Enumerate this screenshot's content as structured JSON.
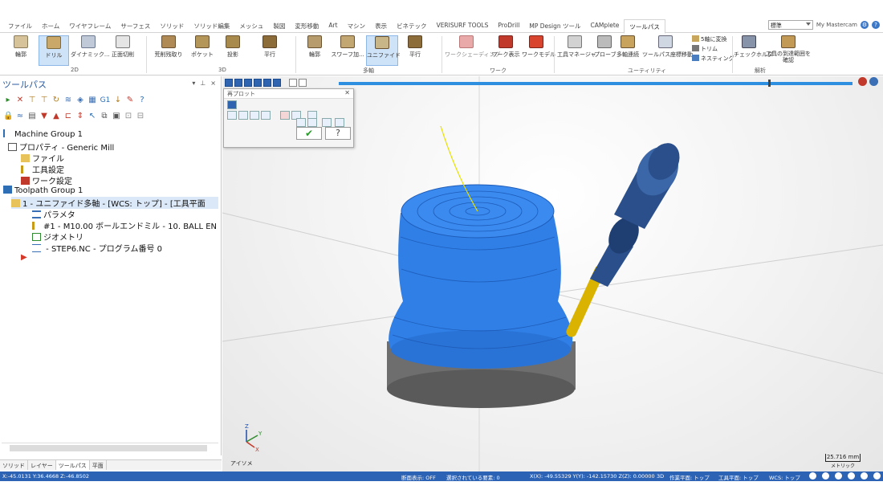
{
  "ribbon_tabs": [
    "ファイル",
    "ホーム",
    "ワイヤフレーム",
    "サーフェス",
    "ソリッド",
    "ソリッド編集",
    "メッシュ",
    "製図",
    "変形移動",
    "Art",
    "マシン",
    "表示",
    "ビネテック",
    "VERISURF TOOLS",
    "ProDrill",
    "MP Design ツール",
    "CAMplete",
    "ツールパス"
  ],
  "active_tab": "ツールパス",
  "style_combo": "標準",
  "brand": "My Mastercam",
  "ribbon": {
    "g2d": [
      "輪郭",
      "ドリル",
      "ダイナミック...",
      "正面切削"
    ],
    "g3d": [
      "荒削残取り",
      "ポケット",
      "投影",
      "平行"
    ],
    "gmulti": [
      "輪郭",
      "スワーフ加...",
      "ユニファイド",
      "平行"
    ],
    "gwork": [
      "ワークシェーディング",
      "ワーク表示",
      "ワークモデル"
    ],
    "gutil": [
      "工具マネージャ",
      "プローブ",
      "多軸連続",
      "ツールパス座標移動"
    ],
    "gutil_small": [
      "5軸に変換",
      "トリム",
      "ネスティング"
    ],
    "ganalysis": [
      "チェックホルダ",
      "工具の到達範囲を確認"
    ],
    "group_labels": [
      "2D",
      "3D",
      "多軸",
      "ワーク",
      "ユーティリティ",
      "解析"
    ]
  },
  "left_panel": {
    "title": "ツールパス",
    "controls": [
      "▾",
      "⊥",
      "×"
    ],
    "tree": [
      "Machine Group 1",
      "プロパティ - Generic Mill",
      "ファイル",
      "工具設定",
      "ワーク設定",
      "Toolpath Group 1",
      "1 - ユニファイド多軸 - [WCS: トップ] - [工具平面",
      "パラメタ",
      "#1 - M10.00 ボールエンドミル - 10. BALL EN",
      "ジオメトリ",
      " - STEP6.NC - プログラム番号 0"
    ]
  },
  "dialog": {
    "title": "再プロット",
    "ok": "✔",
    "help": "?"
  },
  "viewport": {
    "view_label": "アイソメ",
    "scale_value": "25.716 mm",
    "scale_unit": "メトリック"
  },
  "bottom_tabs": [
    "ソリッド",
    "レイヤー",
    "ツールパス",
    "平面"
  ],
  "status": {
    "coords_left": "X:-45.0131  Y:36.4668  Z:-46.8502",
    "section": "断面表示: OFF",
    "selected": "選択されている要素: 0",
    "xyz": "X(X):  -49.55329    Y(Y):  -142.15730  Z(Z):  0.00000",
    "mode": "3D",
    "cplane": "作業平面: トップ",
    "tplane": "工具平面: トップ",
    "wcs": "WCS: トップ"
  },
  "colors": {
    "accent": "#2d63b5",
    "toolpath": "#2f7fe6",
    "holder": "#1f3f73",
    "tool_shank": "#d9b300"
  }
}
